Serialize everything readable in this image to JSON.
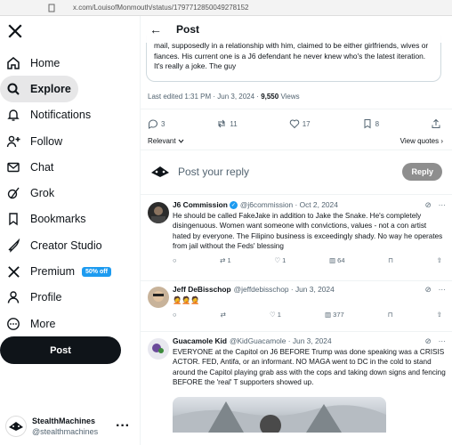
{
  "browser": {
    "url": "x.com/LouisofMonmouth/status/1797712850049278152"
  },
  "sidebar": {
    "items": [
      {
        "label": "Home",
        "icon": "home-icon"
      },
      {
        "label": "Explore",
        "icon": "search-icon"
      },
      {
        "label": "Notifications",
        "icon": "bell-icon"
      },
      {
        "label": "Follow",
        "icon": "person-add-icon"
      },
      {
        "label": "Chat",
        "icon": "envelope-icon"
      },
      {
        "label": "Grok",
        "icon": "grok-icon"
      },
      {
        "label": "Bookmarks",
        "icon": "bookmark-icon"
      },
      {
        "label": "Creator Studio",
        "icon": "rocket-icon"
      },
      {
        "label": "Premium",
        "icon": "x-icon",
        "badge": "50% off"
      },
      {
        "label": "Profile",
        "icon": "person-icon"
      },
      {
        "label": "More",
        "icon": "more-circle-icon"
      }
    ],
    "post_label": "Post",
    "account": {
      "name": "StealthMachines",
      "handle": "@stealthmachines",
      "more": "···"
    }
  },
  "header": {
    "title": "Post",
    "back": "←"
  },
  "main_post": {
    "text": "mail, supposedly in a relationship with him, claimed to be either girlfriends, wives or fiances. His current one is a J6 defendant he never knew who's the latest iteration. It's really a joke. The guy",
    "edited": "Last edited 1:31 PM · Jun 3, 2024 · ",
    "views_count": "9,550",
    "views_label": " Views",
    "stats": {
      "replies": "3",
      "reposts": "11",
      "likes": "17",
      "bookmarks": "8"
    },
    "relevant": "Relevant",
    "view_quotes": "View quotes"
  },
  "reply_box": {
    "placeholder": "Post your reply",
    "button": "Reply"
  },
  "replies": [
    {
      "name": "J6 Commission",
      "handle": "@j6commission · Oct 2, 2024",
      "text": "He should be called FakeJake in addition to Jake the Snake. He's completely disingenuous. Women want someone with convictions, values - not a con artist hated by everyone. The Filipino business is exceedingly shady. No way he operates from jail without the Feds' blessing",
      "replies": "",
      "reposts": "1",
      "likes": "1",
      "views": "64"
    },
    {
      "name": "Jeff DeBisschop",
      "handle": "@jeffdebisschop · Jun 3, 2024",
      "text": "🤦🤦🤦",
      "replies": "",
      "reposts": "",
      "likes": "1",
      "views": "377"
    },
    {
      "name": "Guacamole Kid",
      "handle": "@KidGuacamole · Jun 3, 2024",
      "text": "EVERYONE at the Capitol on J6 BEFORE Trump was done speaking was a CRISIS  ACTOR. FED, Antifa, or an informant. NO MAGA went to DC in the cold to stand around the Capitol playing grab ass with the cops and taking down signs and fencing BEFORE the 'real' T supporters showed up."
    }
  ],
  "colors": {
    "accent": "#1d9bf0",
    "text": "#0f1419",
    "muted": "#536471",
    "reply_btn": "#8e8e8e"
  }
}
